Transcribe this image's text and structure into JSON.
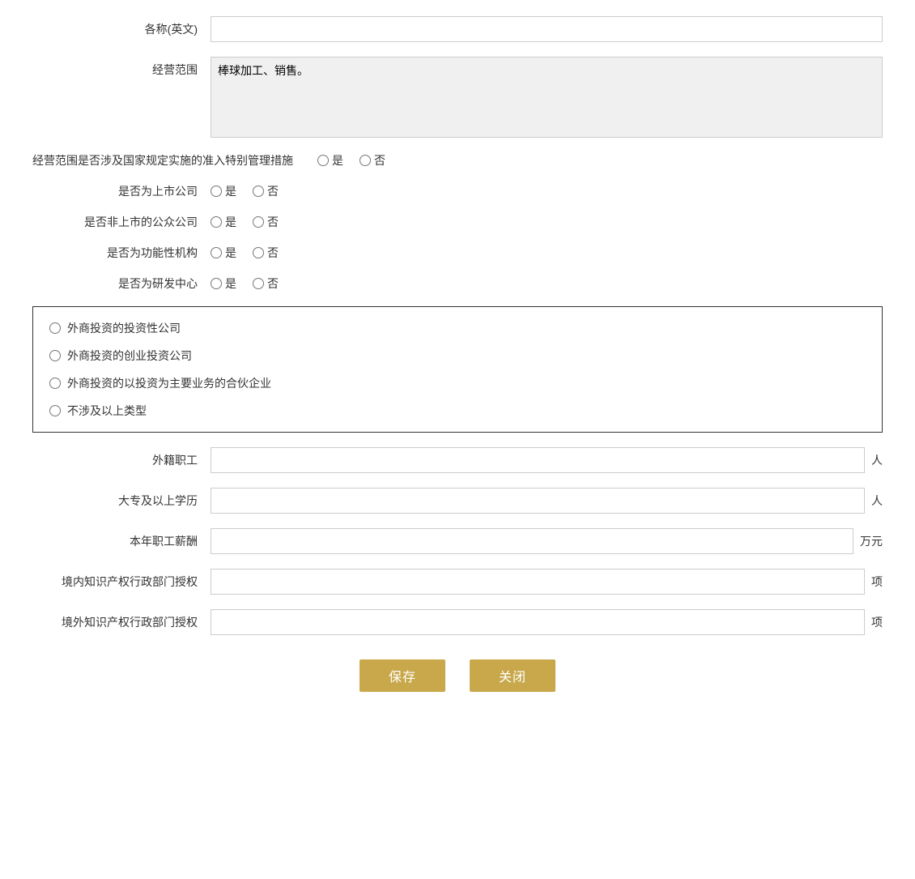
{
  "form": {
    "name_en_label": "各称(英文)",
    "name_en_value": "",
    "name_en_placeholder": "",
    "business_scope_label": "经营范围",
    "business_scope_value": "棒球加工、销售。",
    "special_management_label": "经营范围是否涉及国家规定实施的准入特别管理措施",
    "yes_label": "是",
    "no_label": "否",
    "listed_company_label": "是否为上市公司",
    "non_listed_public_label": "是否非上市的公众公司",
    "functional_institution_label": "是否为功能性机构",
    "rd_center_label": "是否为研发中心",
    "investment_options": [
      "外商投资的投资性公司",
      "外商投资的创业投资公司",
      "外商投资的以投资为主要业务的合伙企业",
      "不涉及以上类型"
    ],
    "foreign_employees_label": "外籍职工",
    "foreign_employees_value": "",
    "foreign_employees_unit": "人",
    "college_above_label": "大专及以上学历",
    "college_above_value": "",
    "college_above_unit": "人",
    "annual_salary_label": "本年职工薪酬",
    "annual_salary_value": "",
    "annual_salary_unit": "万元",
    "domestic_ip_label": "境内知识产权行政部门授权",
    "domestic_ip_value": "",
    "domestic_ip_unit": "项",
    "foreign_ip_label": "境外知识产权行政部门授权",
    "foreign_ip_value": "",
    "foreign_ip_unit": "项",
    "save_btn": "保存",
    "close_btn": "关闭"
  }
}
